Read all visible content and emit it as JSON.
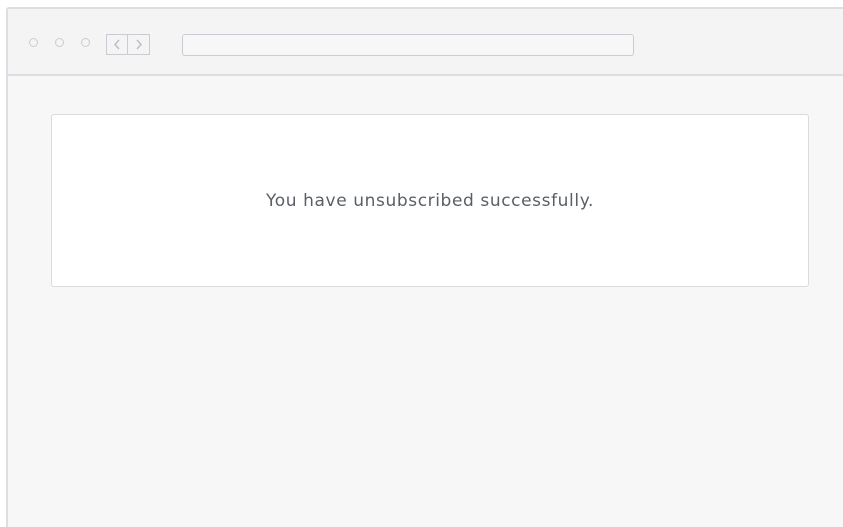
{
  "browser": {
    "window_controls": [
      "window-dot",
      "window-dot",
      "window-dot"
    ],
    "nav": {
      "back_icon": "chevron-left-icon",
      "forward_icon": "chevron-right-icon"
    },
    "address_bar": {
      "value": "",
      "placeholder": ""
    }
  },
  "main": {
    "message": "You have unsubscribed successfully."
  },
  "colors": {
    "frame_border": "#dcdee3",
    "page_background": "#f7f7f7",
    "card_background": "#ffffff",
    "text": "#5a5f66"
  }
}
